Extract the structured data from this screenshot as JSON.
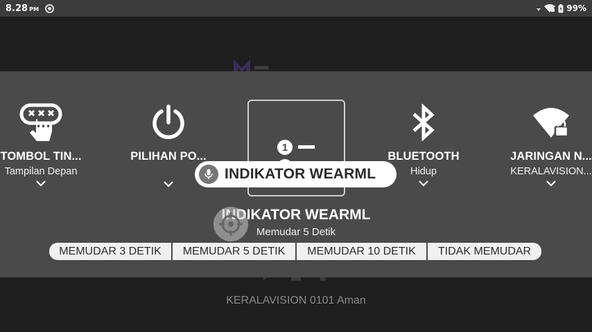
{
  "status_bar": {
    "time": "8.28",
    "ampm": "PM",
    "battery": "99%"
  },
  "background_app": {
    "footer_text": "KERALAVISION 0101 Aman"
  },
  "tiles": [
    {
      "title": "TOMBOL TIN...",
      "subtitle": "Tampilan Depan",
      "icon": "touch-gesture-icon"
    },
    {
      "title": "PILIHAN PO...",
      "subtitle": "",
      "icon": "power-icon"
    },
    {
      "title": "",
      "subtitle": "",
      "icon": "numbered-list-icon"
    },
    {
      "title": "BLUETOOTH",
      "subtitle": "Hidup",
      "icon": "bluetooth-icon"
    },
    {
      "title": "JARINGAN N...",
      "subtitle": "KERALAVISION...",
      "icon": "wifi-lock-icon"
    }
  ],
  "voice_command": {
    "label": "INDIKATOR WEARML"
  },
  "selected": {
    "title": "INDIKATOR WEARML",
    "subtitle": "Memudar 5 Detik"
  },
  "options": [
    "MEMUDAR 3 DETIK",
    "MEMUDAR 5 DETIK",
    "MEMUDAR 10 DETIK",
    "TIDAK MEMUDAR"
  ],
  "colors": {
    "panel": "#4a4a4a",
    "status_bar": "#3c3c3c",
    "background": "#1e1e1e",
    "pill": "#ffffff"
  }
}
